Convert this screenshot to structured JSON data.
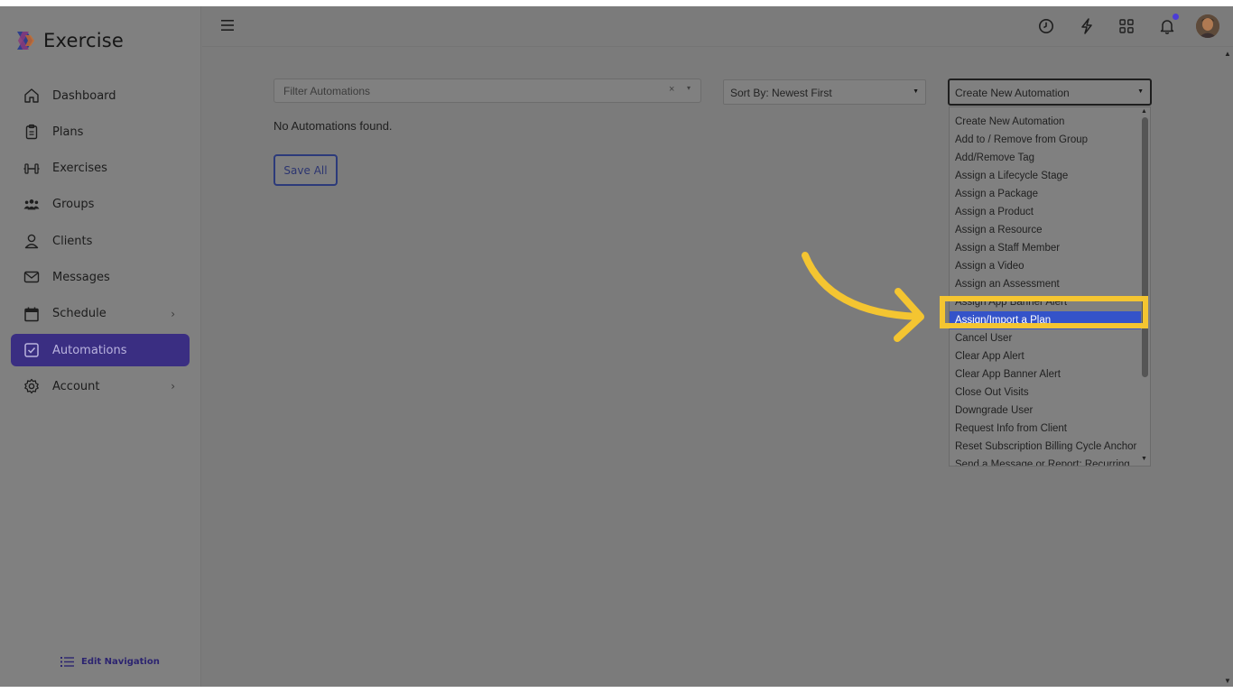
{
  "brand": {
    "name": "Exercise",
    "logo_icon": "exercise-logo-icon"
  },
  "sidebar": {
    "items": [
      {
        "label": "Dashboard",
        "icon": "home-icon",
        "has_chevron": false,
        "active": false
      },
      {
        "label": "Plans",
        "icon": "clipboard-icon",
        "has_chevron": false,
        "active": false
      },
      {
        "label": "Exercises",
        "icon": "dumbbell-icon",
        "has_chevron": false,
        "active": false
      },
      {
        "label": "Groups",
        "icon": "group-icon",
        "has_chevron": false,
        "active": false
      },
      {
        "label": "Clients",
        "icon": "user-icon",
        "has_chevron": false,
        "active": false
      },
      {
        "label": "Messages",
        "icon": "envelope-icon",
        "has_chevron": false,
        "active": false
      },
      {
        "label": "Schedule",
        "icon": "calendar-icon",
        "has_chevron": true,
        "active": false
      },
      {
        "label": "Automations",
        "icon": "checkbox-icon",
        "has_chevron": false,
        "active": true
      },
      {
        "label": "Account",
        "icon": "gear-icon",
        "has_chevron": true,
        "active": false
      }
    ],
    "edit_navigation_label": "Edit Navigation"
  },
  "topbar": {
    "icons": [
      "clock-icon",
      "lightning-icon",
      "apps-grid-icon",
      "bell-icon"
    ],
    "notification_dot_color": "#4c3cd6"
  },
  "main": {
    "filter": {
      "placeholder": "Filter Automations",
      "clear_glyph": "×",
      "caret_glyph": "▾"
    },
    "sort": {
      "value": "Sort By: Newest First"
    },
    "create": {
      "value": "Create New Automation"
    },
    "empty_message": "No Automations found.",
    "save_all_label": "Save All"
  },
  "dropdown": {
    "options": [
      "Create New Automation",
      "Add to / Remove from Group",
      "Add/Remove Tag",
      "Assign a Lifecycle Stage",
      "Assign a Package",
      "Assign a Product",
      "Assign a Resource",
      "Assign a Staff Member",
      "Assign a Video",
      "Assign an Assessment",
      "Assign App Banner Alert",
      "Assign/Import a Plan",
      "Cancel User",
      "Clear App Alert",
      "Clear App Banner Alert",
      "Close Out Visits",
      "Downgrade User",
      "Request Info from Client",
      "Reset Subscription Billing Cycle Anchor",
      "Send a Message or Report: Recurring"
    ],
    "selected": "Assign/Import a Plan"
  },
  "colors": {
    "accent_purple": "#3a2e82",
    "selected_blue": "#3453c9",
    "highlight_yellow": "#f4c531",
    "overlay_gray": "#7b7b7b"
  }
}
